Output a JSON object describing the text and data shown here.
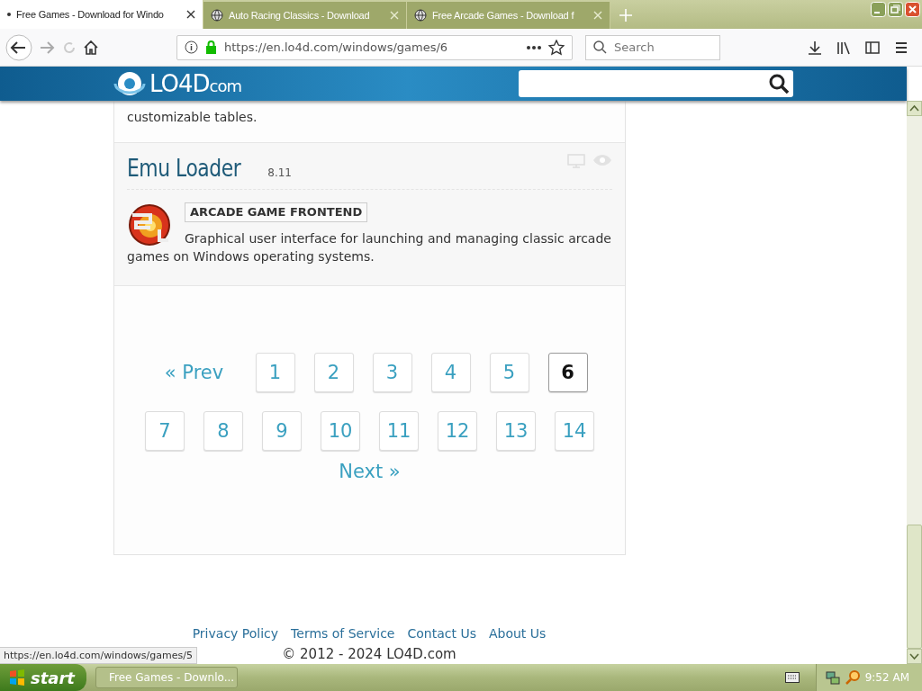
{
  "browser": {
    "tabs": [
      {
        "title": "Free Games - Download for Windo",
        "selected": true
      },
      {
        "title": "Auto Racing Classics - Download",
        "selected": false
      },
      {
        "title": "Free Arcade Games - Download f",
        "selected": false
      }
    ],
    "url": "https://en.lo4d.com/windows/games/6",
    "search_placeholder": "Search"
  },
  "site": {
    "logo": "LO4D",
    "logo_suffix": "com"
  },
  "listings": [
    {
      "kind": "continued",
      "description": "customizable tables."
    },
    {
      "kind": "full",
      "name": "Emu Loader",
      "version": "8.11",
      "category": "ARCADE GAME FRONTEND",
      "description": "Graphical user interface for launching and managing classic arcade games on Windows operating systems."
    }
  ],
  "pagination": {
    "prev": "« Prev",
    "next": "Next »",
    "pages": [
      {
        "label": "1",
        "selected": false
      },
      {
        "label": "2",
        "selected": false
      },
      {
        "label": "3",
        "selected": false
      },
      {
        "label": "4",
        "selected": false
      },
      {
        "label": "5",
        "selected": false
      },
      {
        "label": "6",
        "selected": true
      },
      {
        "label": "7",
        "selected": false
      },
      {
        "label": "8",
        "selected": false
      },
      {
        "label": "9",
        "selected": false
      },
      {
        "label": "10",
        "selected": false
      },
      {
        "label": "11",
        "selected": false
      },
      {
        "label": "12",
        "selected": false
      },
      {
        "label": "13",
        "selected": false
      },
      {
        "label": "14",
        "selected": false
      }
    ]
  },
  "footer": {
    "links": [
      "Privacy Policy",
      "Terms of Service",
      "Contact Us",
      "About Us"
    ],
    "copyright": "© 2012 - 2024 LO4D.com"
  },
  "status_bar": {
    "url": "https://en.lo4d.com/windows/games/5"
  },
  "taskbar": {
    "start": "start",
    "tasks": [
      {
        "title": "Free Games - Downlo..."
      }
    ],
    "clock": "9:52 AM"
  }
}
